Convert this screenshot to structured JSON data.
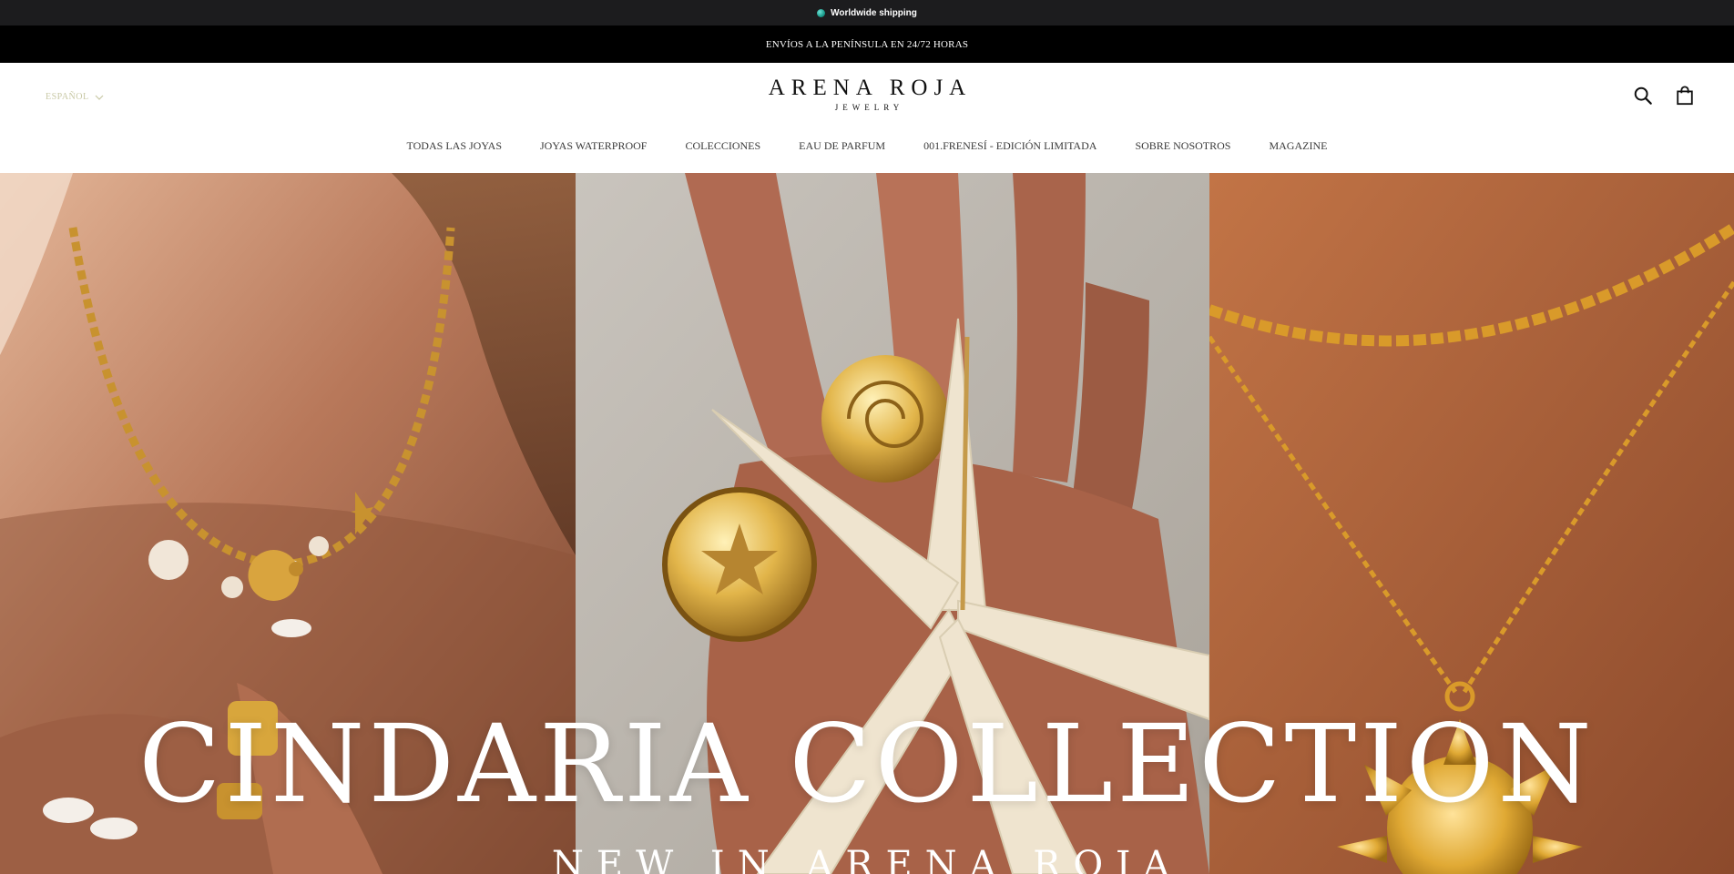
{
  "shipping_bar": {
    "icon": "globe-icon",
    "text": "Worldwide shipping"
  },
  "announcement": {
    "text": "ENVÍOS A LA PENÍNSULA EN 24/72 HORAS"
  },
  "header": {
    "language": "ESPAÑOL",
    "logo": {
      "main": "ARENA ROJA",
      "sub": "JEWELRY"
    },
    "icons": [
      "search-icon",
      "shopping-bag-icon"
    ]
  },
  "nav": {
    "items": [
      {
        "label": "TODAS LAS JOYAS"
      },
      {
        "label": "JOYAS WATERPROOF"
      },
      {
        "label": "COLECCIONES"
      },
      {
        "label": "EAU DE PARFUM"
      },
      {
        "label": "001.FRENESÍ - EDICIÓN LIMITADA"
      },
      {
        "label": "SOBRE NOSOTROS"
      },
      {
        "label": "MAGAZINE"
      }
    ]
  },
  "hero": {
    "title": "CINDARIA COLLECTION",
    "subtitle": "NEW IN ARENA ROJA",
    "colors": {
      "gold": "#d8a63c",
      "skin": "#b06a48",
      "starfish": "#efe4cf"
    }
  }
}
